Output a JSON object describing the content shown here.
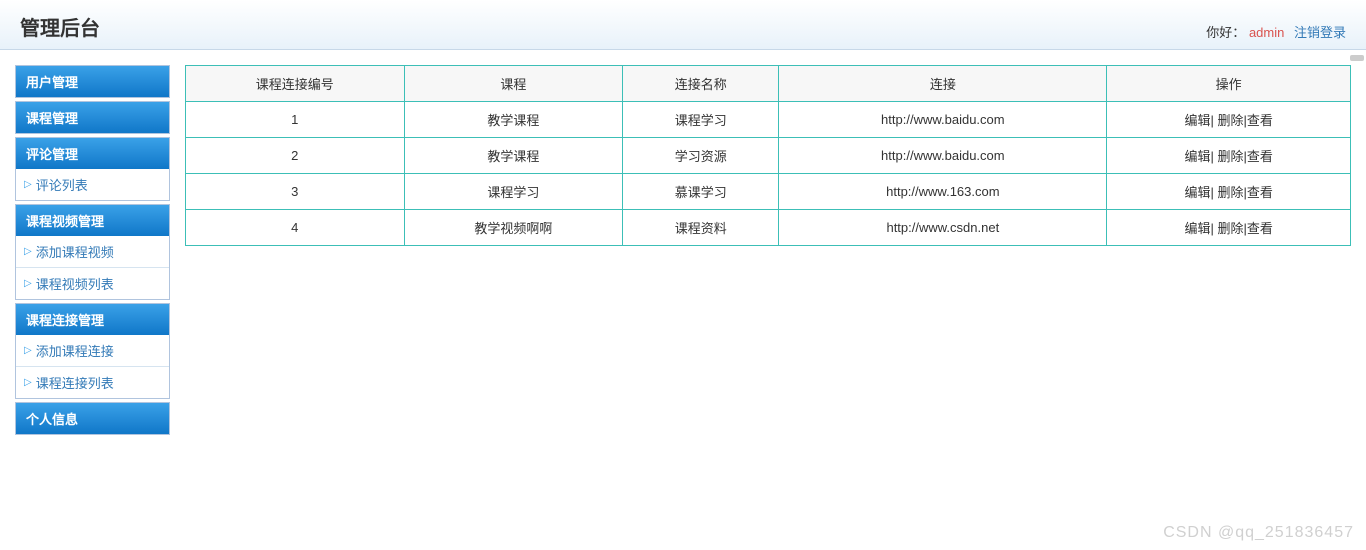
{
  "header": {
    "title": "管理后台",
    "greeting": "你好：",
    "username": "admin",
    "logout": "注销登录"
  },
  "sidebar": {
    "sections": [
      {
        "header": "用户管理",
        "items": []
      },
      {
        "header": "课程管理",
        "items": []
      },
      {
        "header": "评论管理",
        "items": [
          "评论列表"
        ]
      },
      {
        "header": "课程视频管理",
        "items": [
          "添加课程视频",
          "课程视频列表"
        ]
      },
      {
        "header": "课程连接管理",
        "items": [
          "添加课程连接",
          "课程连接列表"
        ]
      },
      {
        "header": "个人信息",
        "items": []
      }
    ]
  },
  "table": {
    "headers": [
      "课程连接编号",
      "课程",
      "连接名称",
      "连接",
      "操作"
    ],
    "rows": [
      {
        "id": "1",
        "course": "教学课程",
        "name": "课程学习",
        "link": "http://www.baidu.com"
      },
      {
        "id": "2",
        "course": "教学课程",
        "name": "学习资源",
        "link": "http://www.baidu.com"
      },
      {
        "id": "3",
        "course": "课程学习",
        "name": "慕课学习",
        "link": "http://www.163.com"
      },
      {
        "id": "4",
        "course": "教学视频啊啊",
        "name": "课程资料",
        "link": "http://www.csdn.net"
      }
    ],
    "actions": {
      "edit": "编辑",
      "delete": "删除",
      "view": "查看"
    }
  },
  "watermark": "CSDN @qq_251836457"
}
